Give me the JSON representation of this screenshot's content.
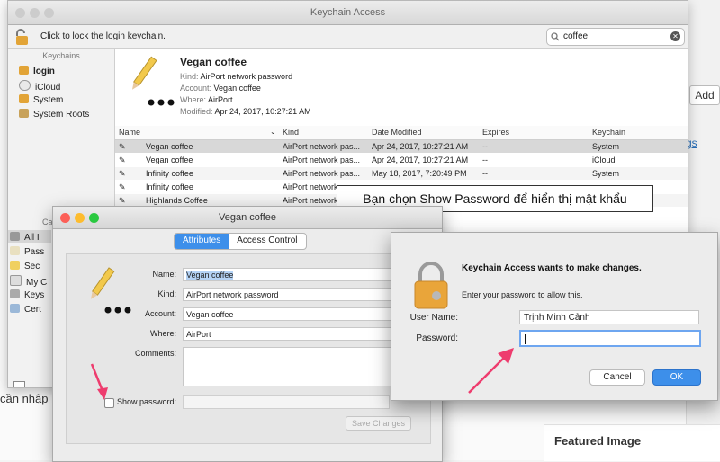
{
  "background": {
    "add_button": "Add",
    "link_text": "gs",
    "featured_image": "Featured Image",
    "left_note": "cần nhập"
  },
  "keychain_window": {
    "title": "Keychain Access",
    "lock_text": "Click to lock the login keychain.",
    "search_value": "coffee",
    "sidebar": {
      "header": "Keychains",
      "items": [
        {
          "label": "login",
          "selected": true
        },
        {
          "label": "iCloud"
        },
        {
          "label": "System"
        },
        {
          "label": "System Roots"
        }
      ],
      "category_header": "Ca",
      "categories": [
        "All I",
        "Pass",
        "Sec",
        "My C",
        "Keys",
        "Cert"
      ]
    },
    "detail": {
      "name": "Vegan coffee",
      "kind_label": "Kind:",
      "kind": "AirPort network password",
      "account_label": "Account:",
      "account": "Vegan coffee",
      "where_label": "Where:",
      "where": "AirPort",
      "modified_label": "Modified:",
      "modified": "Apr 24, 2017, 10:27:21 AM"
    },
    "table": {
      "columns": [
        "Name",
        "Kind",
        "Date Modified",
        "Expires",
        "Keychain"
      ],
      "rows": [
        [
          "Vegan coffee",
          "AirPort network pas...",
          "Apr 24, 2017, 10:27:21 AM",
          "--",
          "System"
        ],
        [
          "Vegan coffee",
          "AirPort network pas...",
          "Apr 24, 2017, 10:27:21 AM",
          "--",
          "iCloud"
        ],
        [
          "Infinity coffee",
          "AirPort network pas...",
          "May 18, 2017, 7:20:49 PM",
          "--",
          "System"
        ],
        [
          "Infinity coffee",
          "AirPort network",
          "",
          "",
          ""
        ],
        [
          "Highlands Coffee",
          "AirPort network",
          "",
          "",
          ""
        ]
      ]
    }
  },
  "callout": "Bạn chọn Show Password để hiển thị mật khẩu",
  "item_dialog": {
    "title": "Vegan coffee",
    "tabs": [
      "Attributes",
      "Access Control"
    ],
    "fields": {
      "name_label": "Name:",
      "name": "Vegan coffee",
      "kind_label": "Kind:",
      "kind": "AirPort network password",
      "account_label": "Account:",
      "account": "Vegan coffee",
      "where_label": "Where:",
      "where": "AirPort",
      "comments_label": "Comments:"
    },
    "show_password_label": "Show password:",
    "save_button": "Save Changes"
  },
  "password_dialog": {
    "title": "Keychain Access wants to make changes.",
    "subtitle": "Enter your password to allow this.",
    "username_label": "User Name:",
    "username": "Trịnh Minh Cảnh",
    "password_label": "Password:",
    "cancel": "Cancel",
    "ok": "OK"
  },
  "colors": {
    "accent": "#3d8fea",
    "arrow": "#ee3c6e"
  }
}
